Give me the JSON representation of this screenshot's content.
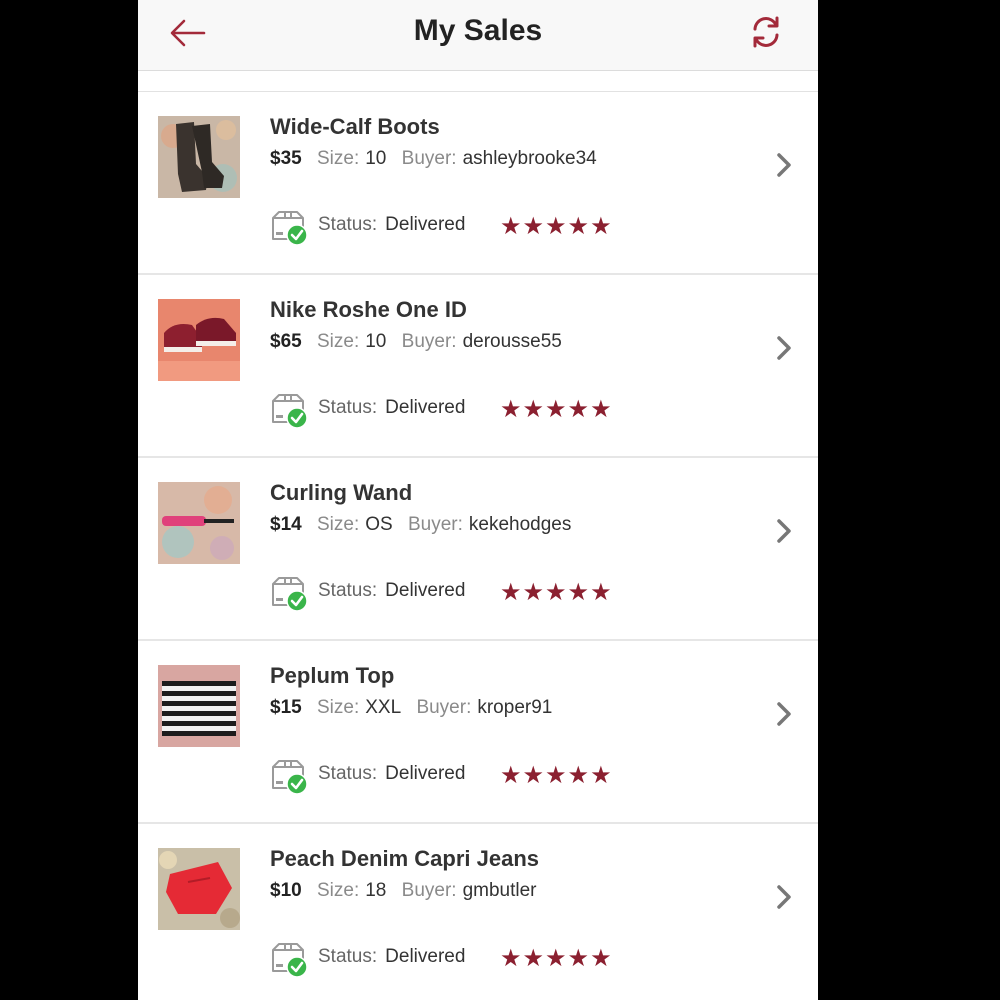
{
  "header": {
    "title": "My Sales",
    "back_icon": "back-arrow-icon",
    "refresh_icon": "refresh-icon",
    "accent": "#a32a3a"
  },
  "colors": {
    "star": "#8b2030",
    "check_badge": "#3ab54a"
  },
  "sales": [
    {
      "name": "Wide-Calf Boots",
      "price": "$35",
      "size_label": "Size:",
      "size": "10",
      "buyer_label": "Buyer:",
      "buyer": "ashleybrooke34",
      "status_label": "Status:",
      "status": "Delivered",
      "rating": "★★★★★",
      "thumb": "boots"
    },
    {
      "name": "Nike Roshe One ID",
      "price": "$65",
      "size_label": "Size:",
      "size": "10",
      "buyer_label": "Buyer:",
      "buyer": "derousse55",
      "status_label": "Status:",
      "status": "Delivered",
      "rating": "★★★★★",
      "thumb": "sneakers"
    },
    {
      "name": "Curling Wand",
      "price": "$14",
      "size_label": "Size:",
      "size": "OS",
      "buyer_label": "Buyer:",
      "buyer": "kekehodges",
      "status_label": "Status:",
      "status": "Delivered",
      "rating": "★★★★★",
      "thumb": "wand"
    },
    {
      "name": "Peplum Top",
      "price": "$15",
      "size_label": "Size:",
      "size": "XXL",
      "buyer_label": "Buyer:",
      "buyer": "kroper91",
      "status_label": "Status:",
      "status": "Delivered",
      "rating": "★★★★★",
      "thumb": "top"
    },
    {
      "name": "Peach Denim Capri Jeans",
      "price": "$10",
      "size_label": "Size:",
      "size": "18",
      "buyer_label": "Buyer:",
      "buyer": "gmbutler",
      "status_label": "Status:",
      "status": "Delivered",
      "rating": "★★★★★",
      "thumb": "jeans"
    }
  ]
}
